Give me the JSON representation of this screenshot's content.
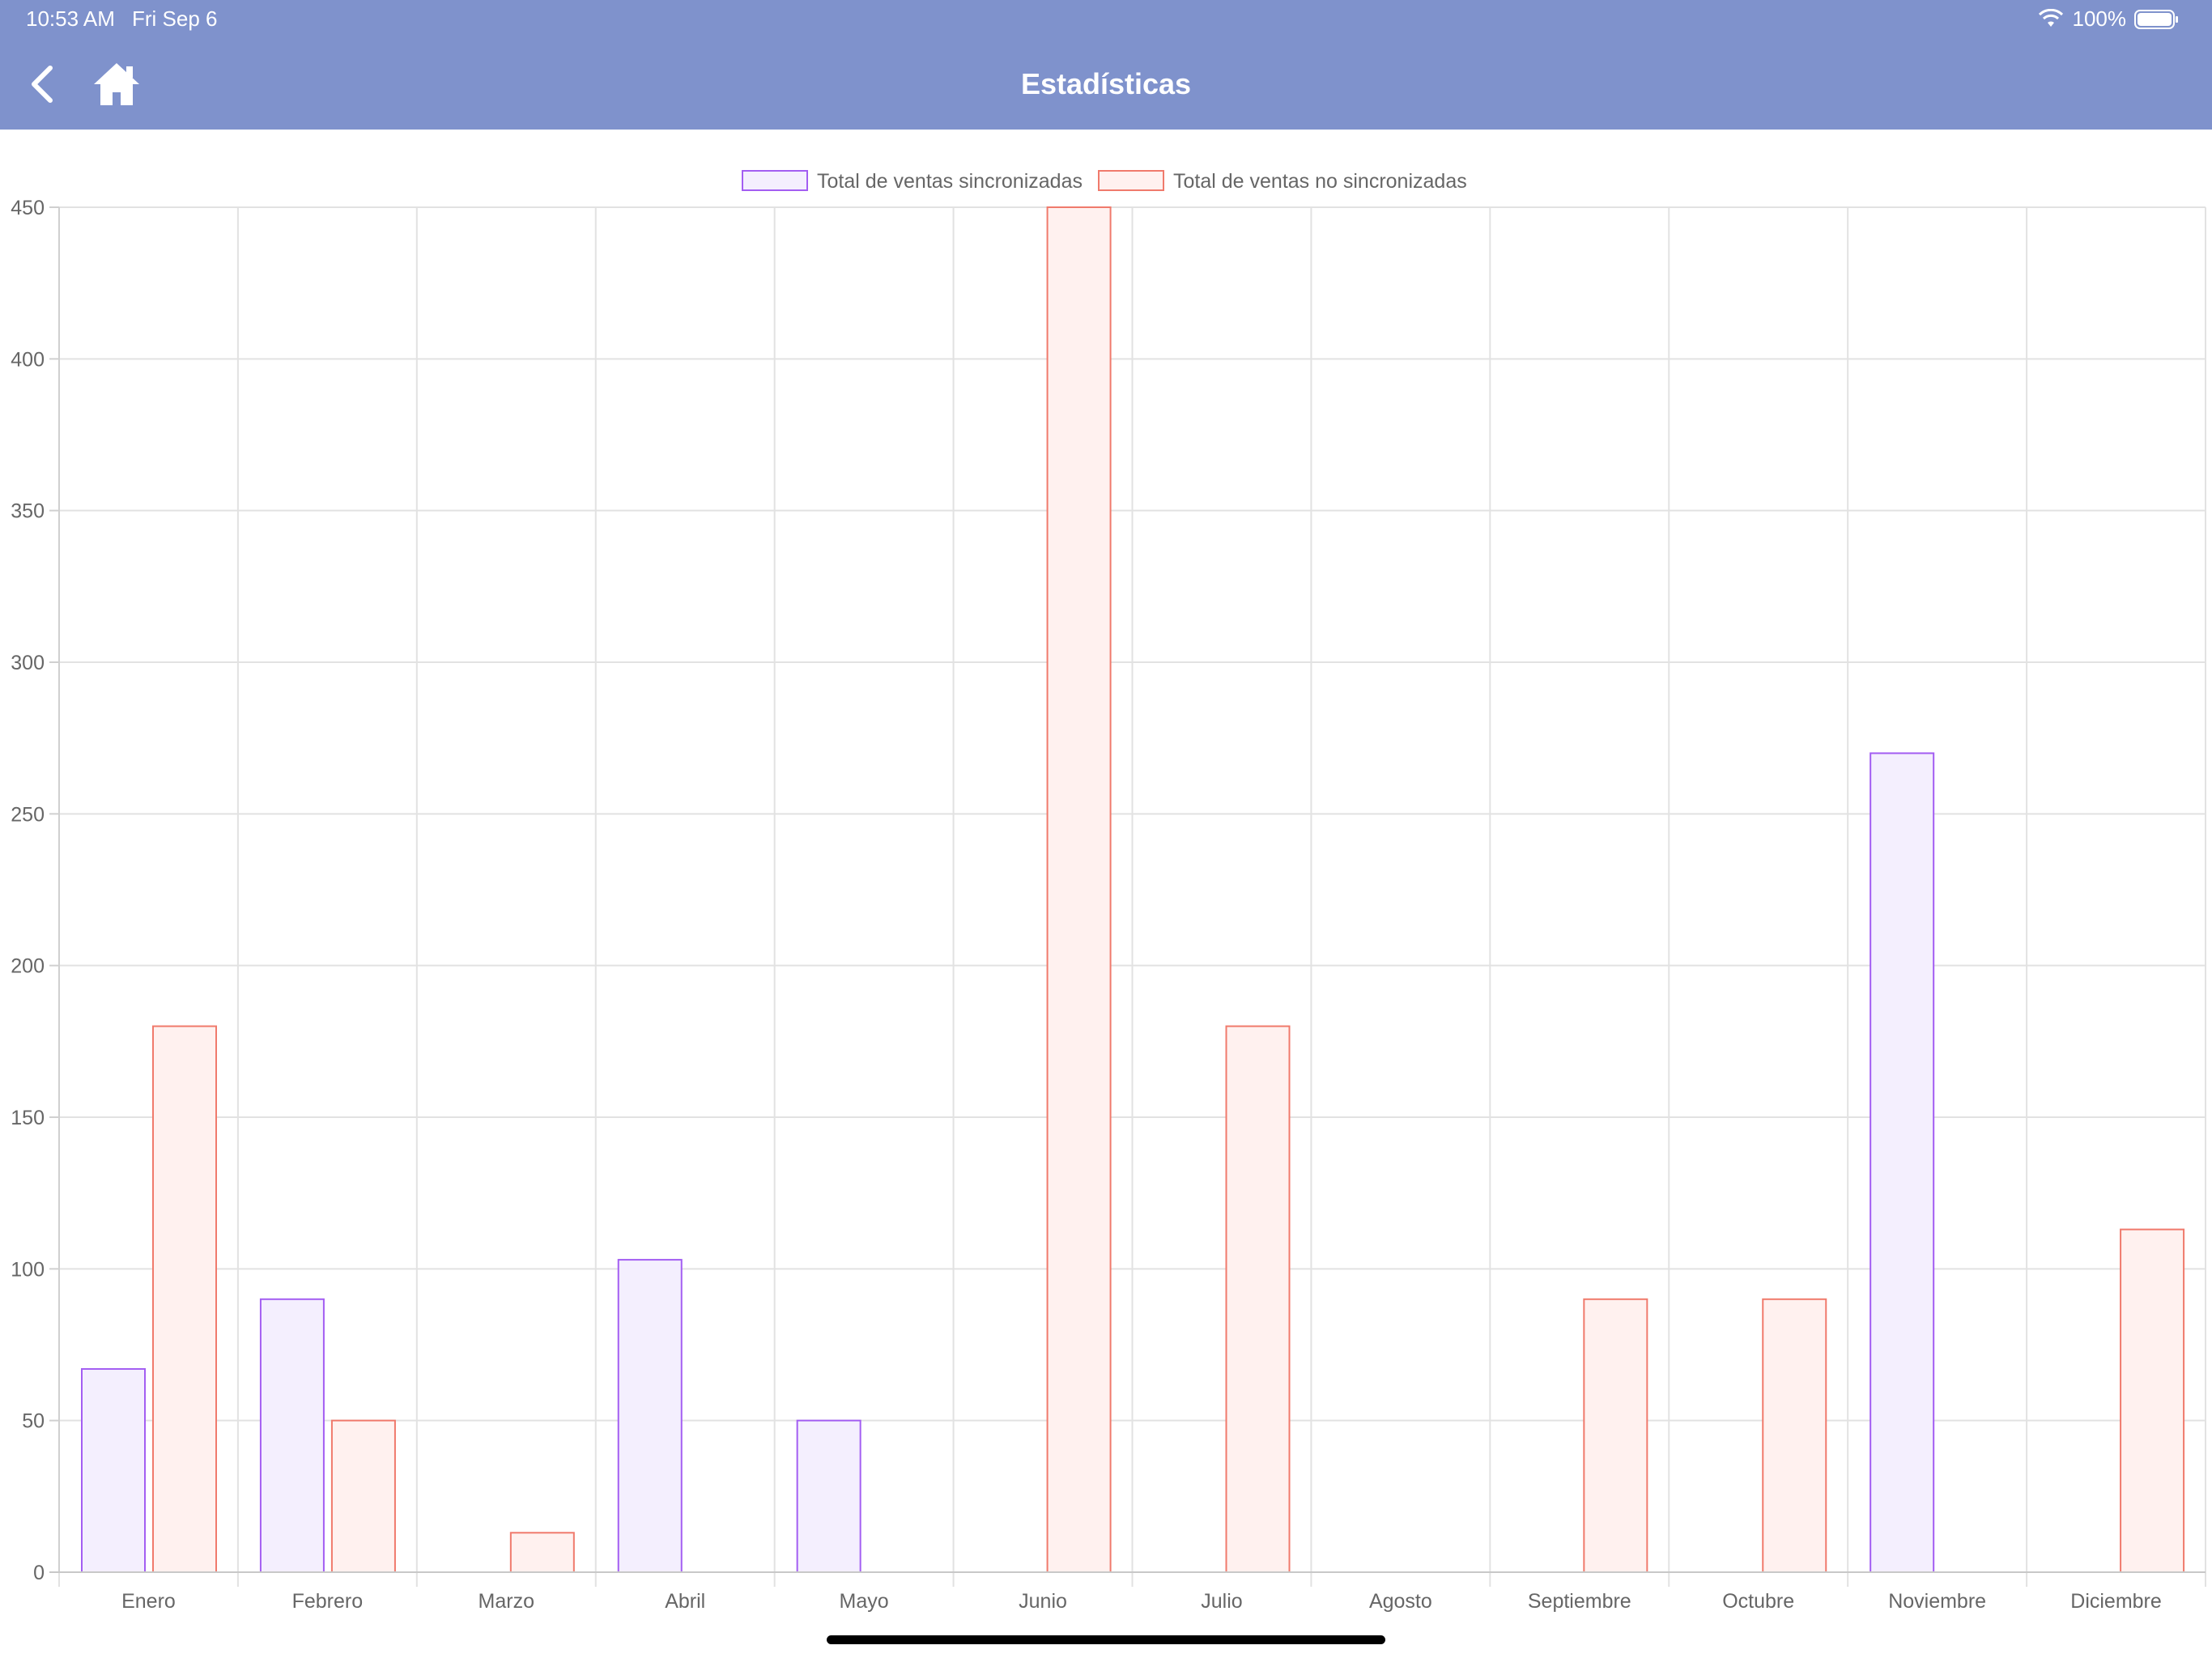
{
  "status_bar": {
    "time": "10:53 AM",
    "date": "Fri Sep 6",
    "battery": "100%",
    "icons": [
      "wifi-icon",
      "battery-icon"
    ]
  },
  "nav": {
    "title": "Estadísticas",
    "back_icon": "chevron-left-icon",
    "home_icon": "home-icon",
    "background": "#7f92cc"
  },
  "chart_data": {
    "type": "bar",
    "categories": [
      "Enero",
      "Febrero",
      "Marzo",
      "Abril",
      "Mayo",
      "Junio",
      "Julio",
      "Agosto",
      "Septiembre",
      "Octubre",
      "Noviembre",
      "Diciembre"
    ],
    "series": [
      {
        "name": "Total de ventas sincronizadas",
        "values": [
          67,
          90,
          0,
          103,
          50,
          0,
          0,
          0,
          0,
          0,
          270,
          0
        ],
        "border": "#a35ef2",
        "fill": "#f4effe"
      },
      {
        "name": "Total de ventas no sincronizadas",
        "values": [
          180,
          50,
          13,
          0,
          0,
          450,
          180,
          0,
          90,
          90,
          0,
          113
        ],
        "border": "#f07a6c",
        "fill": "#fff1ef"
      }
    ],
    "ylim": [
      0,
      450
    ],
    "yticks": [
      "0",
      "50",
      "100",
      "150",
      "200",
      "250",
      "300",
      "350",
      "400",
      "450"
    ],
    "grid": true,
    "legend": "top-center"
  }
}
